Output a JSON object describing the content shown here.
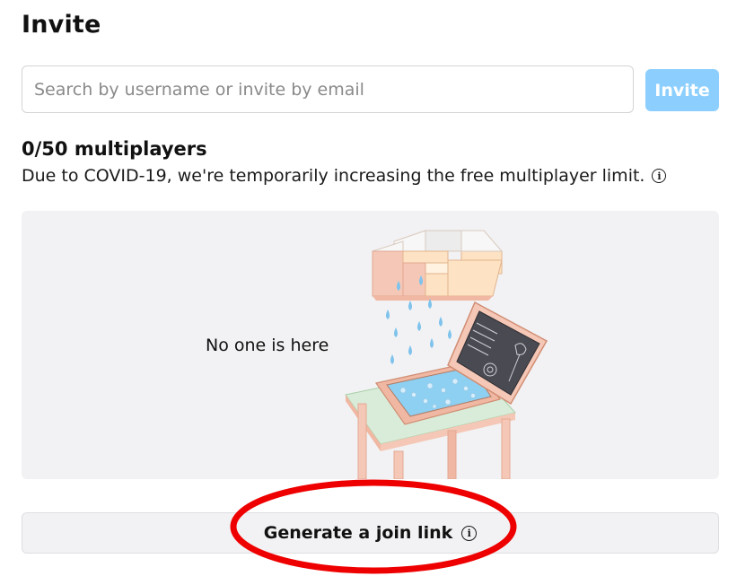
{
  "header": {
    "title": "Invite"
  },
  "search": {
    "placeholder": "Search by username or invite by email",
    "invite_label": "Invite"
  },
  "multiplayers": {
    "count_label": "0/50 multiplayers",
    "notice": "Due to COVID-19, we're temporarily increasing the free multiplayer limit."
  },
  "empty_state": {
    "message": "No one is here",
    "illustration": "rain-cloud-over-laptop-illustration"
  },
  "join": {
    "label": "Generate a join link"
  },
  "icons": {
    "info": "info-icon"
  },
  "colors": {
    "invite_button": "#8ccfff",
    "panel_bg": "#f2f2f4",
    "annotation": "#ee0000"
  }
}
